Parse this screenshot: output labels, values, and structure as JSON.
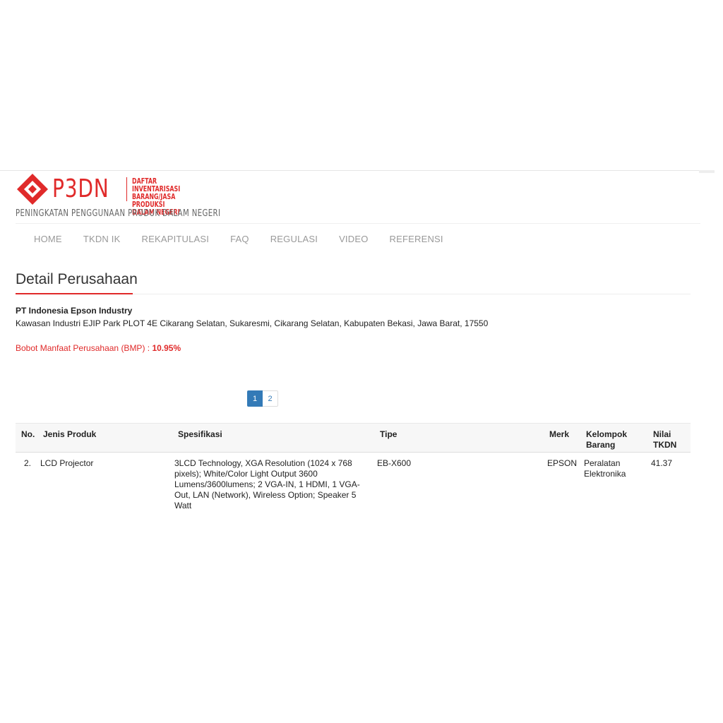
{
  "brand": {
    "logo_text": "P3DN",
    "tagline": "DAFTAR INVENTARISASI\nBARANG/JASA PRODUKSI\nDALAM NEGERI",
    "subtitle": "PENINGKATAN PENGGUNAAN PRODUK DALAM NEGERI",
    "accent_color": "#e02a2a"
  },
  "nav": {
    "items": [
      "HOME",
      "TKDN IK",
      "REKAPITULASI",
      "FAQ",
      "REGULASI",
      "VIDEO",
      "REFERENSI"
    ]
  },
  "page": {
    "title": "Detail Perusahaan"
  },
  "company": {
    "name": "PT Indonesia Epson Industry",
    "address": "Kawasan Industri EJIP Park PLOT 4E Cikarang Selatan, Sukaresmi, Cikarang Selatan, Kabupaten Bekasi, Jawa Barat, 17550",
    "bmp_label": "Bobot Manfaat Perusahaan (BMP) : ",
    "bmp_value": "10.95%"
  },
  "pagination": {
    "pages": [
      "1",
      "2"
    ],
    "active": "1",
    "active_color": "#337ab7"
  },
  "table": {
    "headers": {
      "no": "No.",
      "jenis_produk": "Jenis Produk",
      "spesifikasi": "Spesifikasi",
      "tipe": "Tipe",
      "merk": "Merk",
      "kelompok_barang": "Kelompok Barang",
      "nilai_tkdn": "Nilai TKDN"
    },
    "rows": [
      {
        "no": "2.",
        "jenis_produk": "LCD Projector",
        "spesifikasi": "3LCD Technology, XGA Resolution (1024 x 768 pixels); White/Color Light Output 3600 Lumens/3600lumens; 2 VGA-IN, 1 HDMI, 1 VGA-Out, LAN (Network), Wireless Option; Speaker 5 Watt",
        "tipe": "EB-X600",
        "merk": "EPSON",
        "kelompok_barang": "Peralatan Elektronika",
        "nilai_tkdn": "41.37"
      }
    ]
  }
}
